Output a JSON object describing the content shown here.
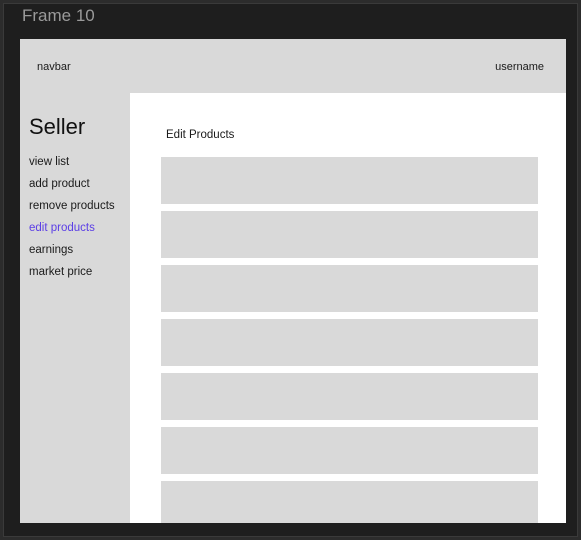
{
  "frame": {
    "label": "Frame 10"
  },
  "navbar": {
    "brand": "navbar",
    "username": "username"
  },
  "sidebar": {
    "title": "Seller",
    "items": [
      {
        "label": "view list",
        "active": false
      },
      {
        "label": "add product",
        "active": false
      },
      {
        "label": "remove products",
        "active": false
      },
      {
        "label": "edit products",
        "active": true
      },
      {
        "label": "earnings",
        "active": false
      },
      {
        "label": "market price",
        "active": false
      }
    ]
  },
  "main": {
    "title": "Edit Products",
    "product_rows": 7
  },
  "colors": {
    "active_link": "#5b3ee6",
    "placeholder_gray": "#d9d9d9",
    "canvas_dark": "#2c2c2c"
  }
}
